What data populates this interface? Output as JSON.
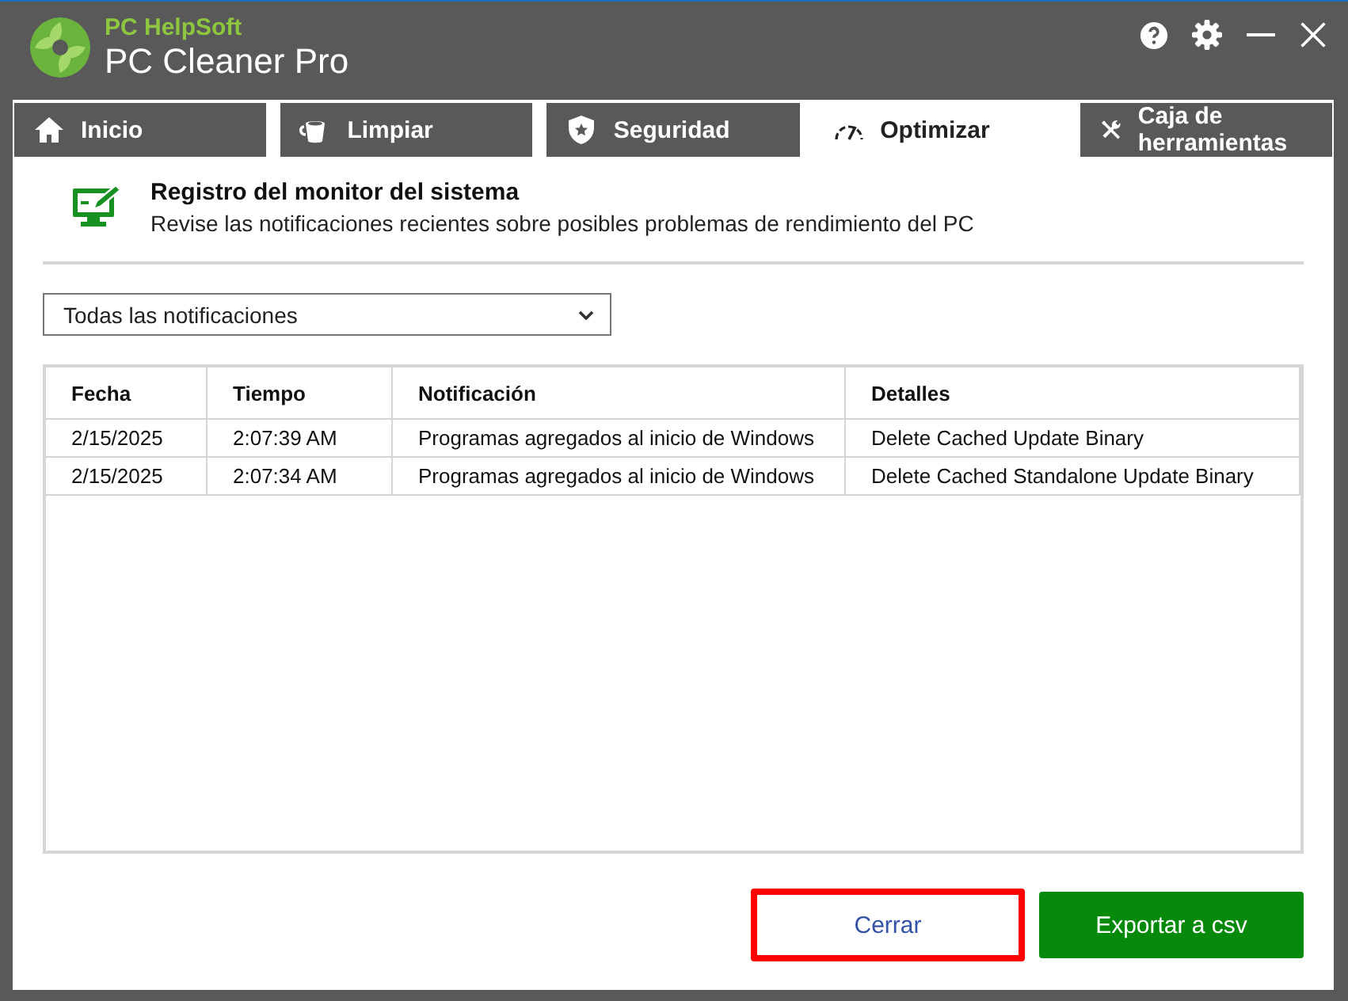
{
  "app": {
    "vendor": "PC HelpSoft",
    "title": "PC Cleaner Pro"
  },
  "tabs": [
    {
      "label": "Inicio",
      "kind": "home",
      "selected": false
    },
    {
      "label": "Limpiar",
      "kind": "clean",
      "selected": false
    },
    {
      "label": "Seguridad",
      "kind": "shield",
      "selected": false
    },
    {
      "label": "Optimizar",
      "kind": "gauge",
      "selected": true
    },
    {
      "label": "Caja de herramientas",
      "kind": "tools",
      "selected": false
    }
  ],
  "header": {
    "title": "Registro del monitor del sistema",
    "subtitle": "Revise las notificaciones recientes sobre posibles problemas de rendimiento del PC"
  },
  "filter": {
    "value": "Todas las notificaciones"
  },
  "table": {
    "columns": [
      "Fecha",
      "Tiempo",
      "Notificación",
      "Detalles"
    ],
    "rows": [
      [
        "2/15/2025",
        "2:07:39 AM",
        "Programas agregados al inicio de Windows",
        "Delete Cached Update Binary"
      ],
      [
        "2/15/2025",
        "2:07:34 AM",
        "Programas agregados al inicio de Windows",
        "Delete Cached Standalone Update Binary"
      ]
    ]
  },
  "buttons": [
    {
      "label": "Cerrar",
      "kind": "secondary",
      "highlighted": true
    },
    {
      "label": "Exportar a csv",
      "kind": "primary",
      "highlighted": false
    }
  ]
}
